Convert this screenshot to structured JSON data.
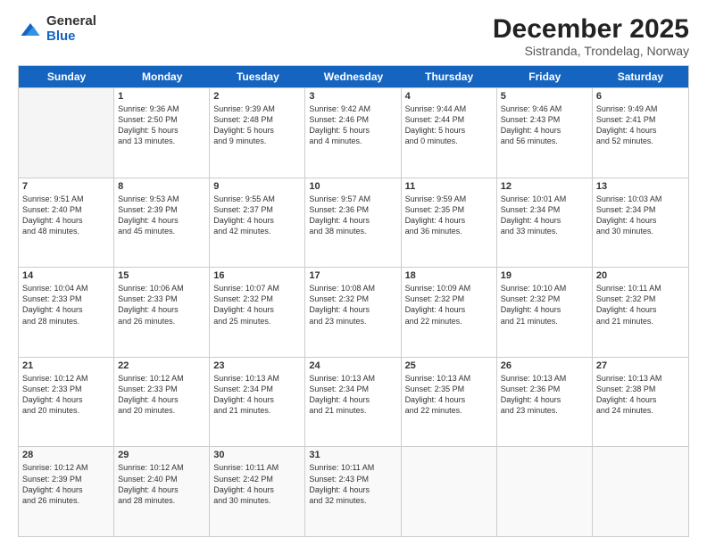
{
  "logo": {
    "general": "General",
    "blue": "Blue"
  },
  "title": "December 2025",
  "subtitle": "Sistranda, Trondelag, Norway",
  "header_days": [
    "Sunday",
    "Monday",
    "Tuesday",
    "Wednesday",
    "Thursday",
    "Friday",
    "Saturday"
  ],
  "weeks": [
    [
      {
        "day": "",
        "empty": true,
        "lines": []
      },
      {
        "day": "1",
        "empty": false,
        "lines": [
          "Sunrise: 9:36 AM",
          "Sunset: 2:50 PM",
          "Daylight: 5 hours",
          "and 13 minutes."
        ]
      },
      {
        "day": "2",
        "empty": false,
        "lines": [
          "Sunrise: 9:39 AM",
          "Sunset: 2:48 PM",
          "Daylight: 5 hours",
          "and 9 minutes."
        ]
      },
      {
        "day": "3",
        "empty": false,
        "lines": [
          "Sunrise: 9:42 AM",
          "Sunset: 2:46 PM",
          "Daylight: 5 hours",
          "and 4 minutes."
        ]
      },
      {
        "day": "4",
        "empty": false,
        "lines": [
          "Sunrise: 9:44 AM",
          "Sunset: 2:44 PM",
          "Daylight: 5 hours",
          "and 0 minutes."
        ]
      },
      {
        "day": "5",
        "empty": false,
        "lines": [
          "Sunrise: 9:46 AM",
          "Sunset: 2:43 PM",
          "Daylight: 4 hours",
          "and 56 minutes."
        ]
      },
      {
        "day": "6",
        "empty": false,
        "lines": [
          "Sunrise: 9:49 AM",
          "Sunset: 2:41 PM",
          "Daylight: 4 hours",
          "and 52 minutes."
        ]
      }
    ],
    [
      {
        "day": "7",
        "empty": false,
        "lines": [
          "Sunrise: 9:51 AM",
          "Sunset: 2:40 PM",
          "Daylight: 4 hours",
          "and 48 minutes."
        ]
      },
      {
        "day": "8",
        "empty": false,
        "lines": [
          "Sunrise: 9:53 AM",
          "Sunset: 2:39 PM",
          "Daylight: 4 hours",
          "and 45 minutes."
        ]
      },
      {
        "day": "9",
        "empty": false,
        "lines": [
          "Sunrise: 9:55 AM",
          "Sunset: 2:37 PM",
          "Daylight: 4 hours",
          "and 42 minutes."
        ]
      },
      {
        "day": "10",
        "empty": false,
        "lines": [
          "Sunrise: 9:57 AM",
          "Sunset: 2:36 PM",
          "Daylight: 4 hours",
          "and 38 minutes."
        ]
      },
      {
        "day": "11",
        "empty": false,
        "lines": [
          "Sunrise: 9:59 AM",
          "Sunset: 2:35 PM",
          "Daylight: 4 hours",
          "and 36 minutes."
        ]
      },
      {
        "day": "12",
        "empty": false,
        "lines": [
          "Sunrise: 10:01 AM",
          "Sunset: 2:34 PM",
          "Daylight: 4 hours",
          "and 33 minutes."
        ]
      },
      {
        "day": "13",
        "empty": false,
        "lines": [
          "Sunrise: 10:03 AM",
          "Sunset: 2:34 PM",
          "Daylight: 4 hours",
          "and 30 minutes."
        ]
      }
    ],
    [
      {
        "day": "14",
        "empty": false,
        "lines": [
          "Sunrise: 10:04 AM",
          "Sunset: 2:33 PM",
          "Daylight: 4 hours",
          "and 28 minutes."
        ]
      },
      {
        "day": "15",
        "empty": false,
        "lines": [
          "Sunrise: 10:06 AM",
          "Sunset: 2:33 PM",
          "Daylight: 4 hours",
          "and 26 minutes."
        ]
      },
      {
        "day": "16",
        "empty": false,
        "lines": [
          "Sunrise: 10:07 AM",
          "Sunset: 2:32 PM",
          "Daylight: 4 hours",
          "and 25 minutes."
        ]
      },
      {
        "day": "17",
        "empty": false,
        "lines": [
          "Sunrise: 10:08 AM",
          "Sunset: 2:32 PM",
          "Daylight: 4 hours",
          "and 23 minutes."
        ]
      },
      {
        "day": "18",
        "empty": false,
        "lines": [
          "Sunrise: 10:09 AM",
          "Sunset: 2:32 PM",
          "Daylight: 4 hours",
          "and 22 minutes."
        ]
      },
      {
        "day": "19",
        "empty": false,
        "lines": [
          "Sunrise: 10:10 AM",
          "Sunset: 2:32 PM",
          "Daylight: 4 hours",
          "and 21 minutes."
        ]
      },
      {
        "day": "20",
        "empty": false,
        "lines": [
          "Sunrise: 10:11 AM",
          "Sunset: 2:32 PM",
          "Daylight: 4 hours",
          "and 21 minutes."
        ]
      }
    ],
    [
      {
        "day": "21",
        "empty": false,
        "lines": [
          "Sunrise: 10:12 AM",
          "Sunset: 2:33 PM",
          "Daylight: 4 hours",
          "and 20 minutes."
        ]
      },
      {
        "day": "22",
        "empty": false,
        "lines": [
          "Sunrise: 10:12 AM",
          "Sunset: 2:33 PM",
          "Daylight: 4 hours",
          "and 20 minutes."
        ]
      },
      {
        "day": "23",
        "empty": false,
        "lines": [
          "Sunrise: 10:13 AM",
          "Sunset: 2:34 PM",
          "Daylight: 4 hours",
          "and 21 minutes."
        ]
      },
      {
        "day": "24",
        "empty": false,
        "lines": [
          "Sunrise: 10:13 AM",
          "Sunset: 2:34 PM",
          "Daylight: 4 hours",
          "and 21 minutes."
        ]
      },
      {
        "day": "25",
        "empty": false,
        "lines": [
          "Sunrise: 10:13 AM",
          "Sunset: 2:35 PM",
          "Daylight: 4 hours",
          "and 22 minutes."
        ]
      },
      {
        "day": "26",
        "empty": false,
        "lines": [
          "Sunrise: 10:13 AM",
          "Sunset: 2:36 PM",
          "Daylight: 4 hours",
          "and 23 minutes."
        ]
      },
      {
        "day": "27",
        "empty": false,
        "lines": [
          "Sunrise: 10:13 AM",
          "Sunset: 2:38 PM",
          "Daylight: 4 hours",
          "and 24 minutes."
        ]
      }
    ],
    [
      {
        "day": "28",
        "empty": false,
        "lines": [
          "Sunrise: 10:12 AM",
          "Sunset: 2:39 PM",
          "Daylight: 4 hours",
          "and 26 minutes."
        ]
      },
      {
        "day": "29",
        "empty": false,
        "lines": [
          "Sunrise: 10:12 AM",
          "Sunset: 2:40 PM",
          "Daylight: 4 hours",
          "and 28 minutes."
        ]
      },
      {
        "day": "30",
        "empty": false,
        "lines": [
          "Sunrise: 10:11 AM",
          "Sunset: 2:42 PM",
          "Daylight: 4 hours",
          "and 30 minutes."
        ]
      },
      {
        "day": "31",
        "empty": false,
        "lines": [
          "Sunrise: 10:11 AM",
          "Sunset: 2:43 PM",
          "Daylight: 4 hours",
          "and 32 minutes."
        ]
      },
      {
        "day": "",
        "empty": true,
        "lines": []
      },
      {
        "day": "",
        "empty": true,
        "lines": []
      },
      {
        "day": "",
        "empty": true,
        "lines": []
      }
    ]
  ]
}
